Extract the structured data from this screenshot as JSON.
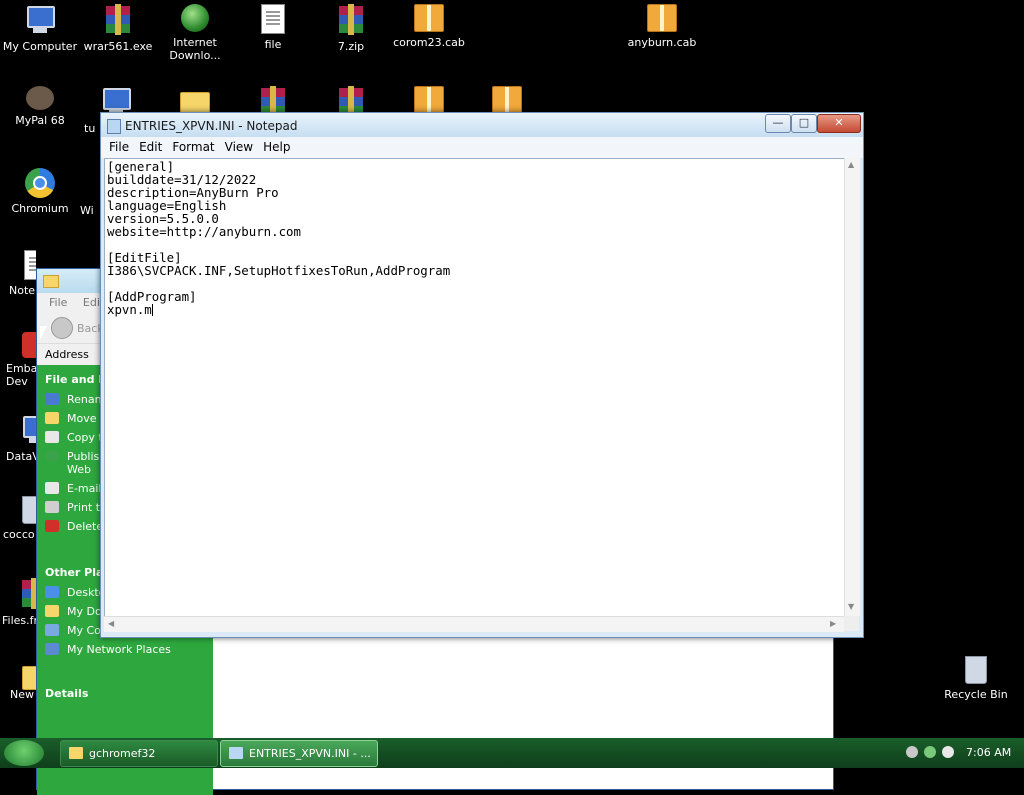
{
  "desktop": {
    "icons": [
      {
        "label": "My Computer"
      },
      {
        "label": "wrar561.exe"
      },
      {
        "label": "Internet Downlo..."
      },
      {
        "label": "file"
      },
      {
        "label": "7.zip"
      },
      {
        "label": "corom23.cab"
      },
      {
        "label": "anyburn.cab"
      },
      {
        "label": "MyPal 68"
      },
      {
        "label": "tu"
      },
      {
        "label": "Chromium"
      },
      {
        "label": "Wi"
      },
      {
        "label": "Note"
      },
      {
        "label": "Emba Dev"
      },
      {
        "label": "DataV"
      },
      {
        "label": "cocco"
      },
      {
        "label": "Files.fr"
      },
      {
        "label": "New"
      },
      {
        "label": "Recycle Bin"
      }
    ]
  },
  "explorer": {
    "menu": [
      "File",
      "Edi"
    ],
    "back_label": "Back",
    "address_label": "Address",
    "file_tasks_header": "File and Fo",
    "file_tasks": [
      "Renam",
      "Move",
      "Copy t",
      "Publis Web",
      "E-mail",
      "Print t",
      "Delete"
    ],
    "other_places_header": "Other Plac",
    "other_places": [
      "Deskto",
      "My Documents",
      "My Computer",
      "My Network Places"
    ],
    "details_header": "Details"
  },
  "notepad": {
    "title": "ENTRIES_XPVN.INI - Notepad",
    "menu": [
      "File",
      "Edit",
      "Format",
      "View",
      "Help"
    ],
    "lines": [
      "[general]",
      "builddate=31/12/2022",
      "description=AnyBurn Pro",
      "language=English",
      "version=5.5.0.0",
      "website=http://anyburn.com",
      "",
      "[EditFile]",
      "I386\\SVCPACK.INF,SetupHotfixesToRun,AddProgram",
      "",
      "[AddProgram]",
      "xpvn.m"
    ]
  },
  "taskbar": {
    "tasks": [
      {
        "label": "gchromef32"
      },
      {
        "label": "ENTRIES_XPVN.INI - ..."
      }
    ],
    "clock": "7:06 AM"
  }
}
